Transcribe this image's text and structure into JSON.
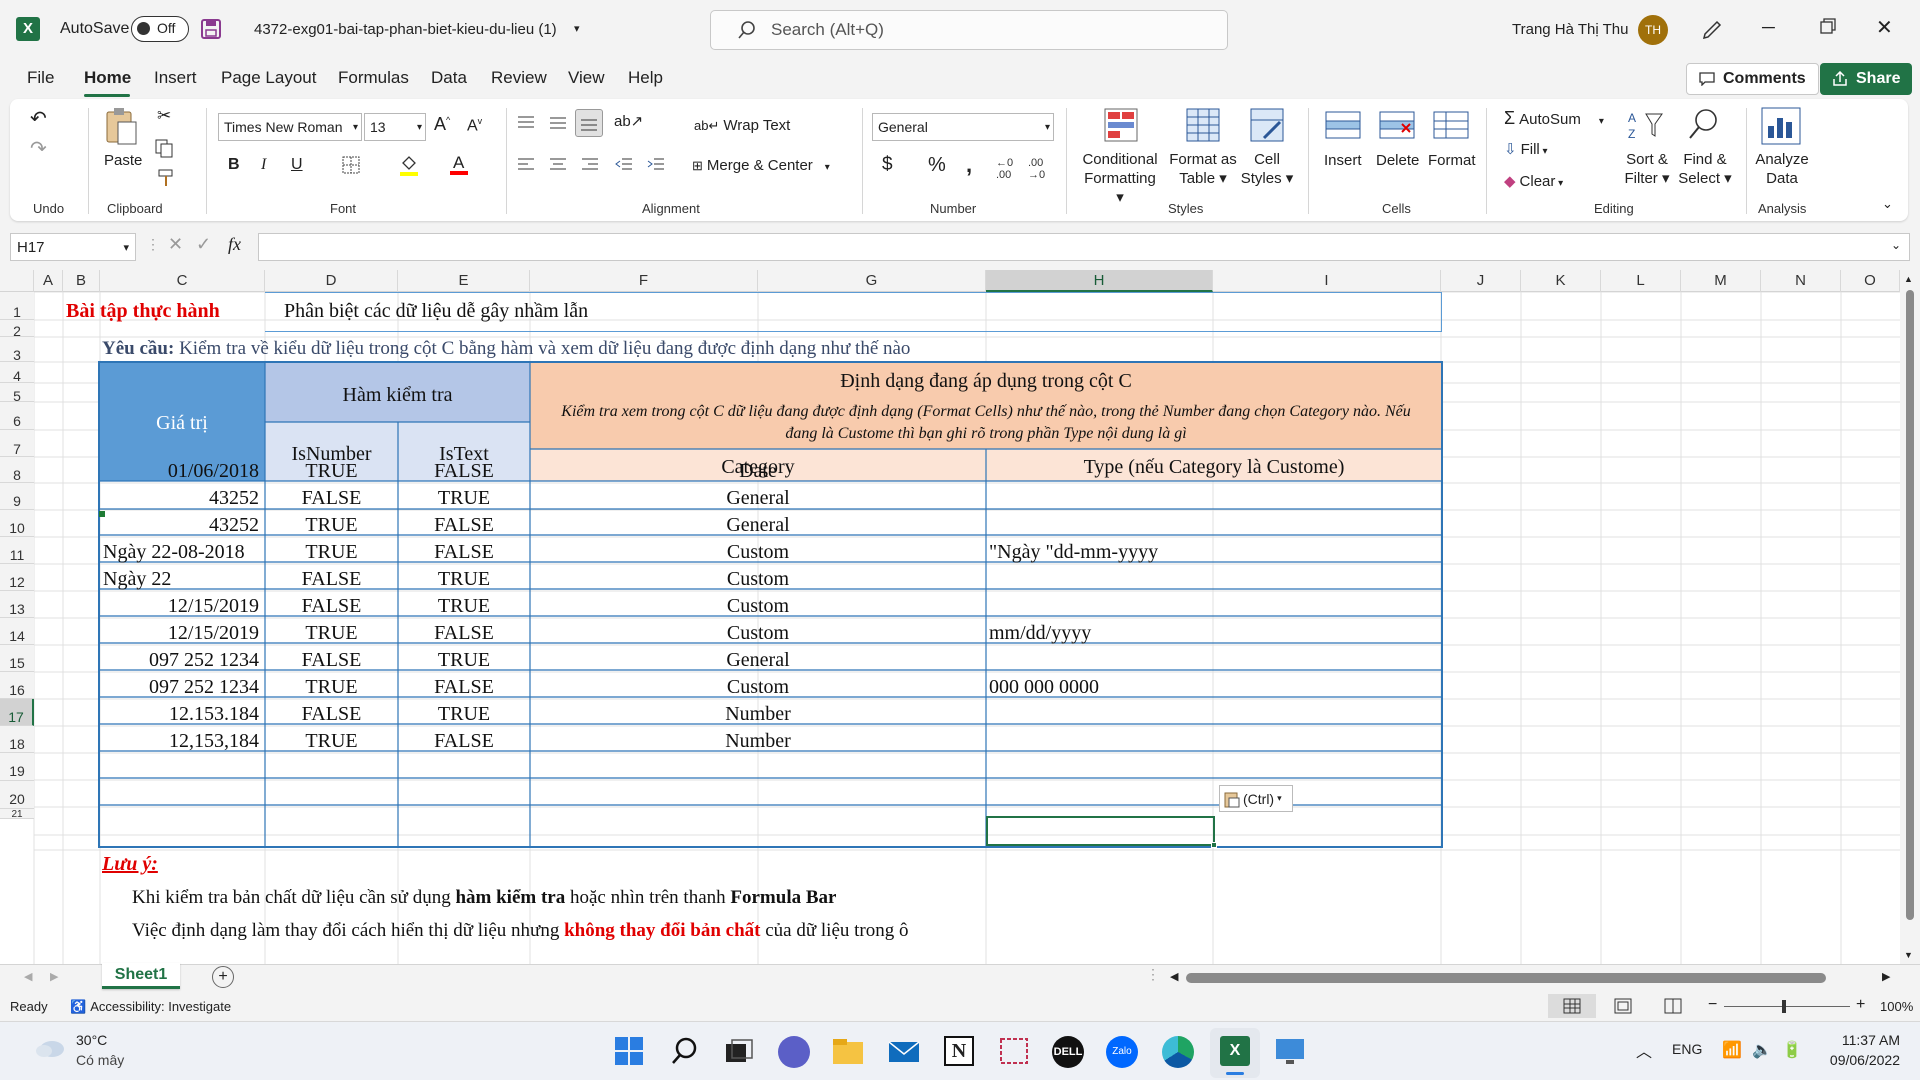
{
  "titlebar": {
    "autosave_label": "AutoSave",
    "autosave_state": "Off",
    "filename": "4372-exg01-bai-tap-phan-biet-kieu-du-lieu (1)",
    "search_placeholder": "Search (Alt+Q)",
    "user_name": "Trang Hà Thị Thu",
    "user_initials": "TH"
  },
  "menu": [
    "File",
    "Home",
    "Insert",
    "Page Layout",
    "Formulas",
    "Data",
    "Review",
    "View",
    "Help"
  ],
  "top_buttons": {
    "comments": "Comments",
    "share": "Share"
  },
  "ribbon": {
    "undo_label": "Undo",
    "clipboard": {
      "paste": "Paste",
      "label": "Clipboard"
    },
    "font": {
      "name": "Times New Roman",
      "size": "13",
      "label": "Font",
      "bold": "B",
      "italic": "I",
      "underline": "U"
    },
    "alignment": {
      "wrap_text": "Wrap Text",
      "merge_center": "Merge & Center",
      "label": "Alignment"
    },
    "number": {
      "format": "General",
      "label": "Number"
    },
    "styles": {
      "conditional": [
        "Conditional",
        "Formatting"
      ],
      "format_table": [
        "Format as",
        "Table"
      ],
      "cell_styles": [
        "Cell",
        "Styles"
      ],
      "label": "Styles"
    },
    "cells": {
      "insert": "Insert",
      "delete": "Delete",
      "format": "Format",
      "label": "Cells"
    },
    "editing": {
      "autosum": "AutoSum",
      "fill": "Fill",
      "clear": "Clear",
      "sort_filter": [
        "Sort &",
        "Filter"
      ],
      "find_select": [
        "Find &",
        "Select"
      ],
      "label": "Editing"
    },
    "analysis": {
      "analyze": [
        "Analyze",
        "Data"
      ],
      "label": "Analysis"
    }
  },
  "formula_bar": {
    "name_box": "H17",
    "fx": "fx",
    "content": ""
  },
  "columns": [
    "A",
    "B",
    "C",
    "D",
    "E",
    "F",
    "G",
    "H",
    "I",
    "J",
    "K",
    "L",
    "M",
    "N",
    "O"
  ],
  "rows": [
    "1",
    "2",
    "3",
    "4",
    "5",
    "6",
    "7",
    "8",
    "9",
    "10",
    "11",
    "12",
    "13",
    "14",
    "15",
    "16",
    "17",
    "18",
    "19",
    "20"
  ],
  "sheet": {
    "title_label": "Bài tập thực hành",
    "title_text": "Phân biệt các dữ liệu dễ gây nhầm lẫn",
    "req_label": "Yêu cầu:",
    "req_text": " Kiểm tra về kiểu dữ liệu trong cột C bằng hàm và xem dữ liệu đang được định dạng như thế nào",
    "hdr_value": "Giá trị",
    "hdr_check": "Hàm kiểm tra",
    "hdr_isnumber": "IsNumber",
    "hdr_istext": "IsText",
    "hdr_format": "Định dạng đang áp dụng trong cột C",
    "hdr_format_note": "Kiểm tra xem trong cột C dữ liệu đang được định dạng (Format Cells) như thế nào, trong thẻ Number đang chọn Category nào. Nếu đang là Custome thì bạn ghi rõ trong phần Type nội dung là gì",
    "hdr_category": "Category",
    "hdr_type": "Type (nếu Category là Custome)",
    "table": [
      {
        "value": "01/06/2018",
        "align": "r",
        "isnum": "TRUE",
        "istext": "FALSE",
        "category": "Date",
        "type": ""
      },
      {
        "value": "43252",
        "align": "r",
        "isnum": "FALSE",
        "istext": "TRUE",
        "category": "General",
        "type": ""
      },
      {
        "value": "43252",
        "align": "r",
        "isnum": "TRUE",
        "istext": "FALSE",
        "category": "General",
        "type": ""
      },
      {
        "value": "Ngày 22-08-2018",
        "align": "l",
        "isnum": "TRUE",
        "istext": "FALSE",
        "category": "Custom",
        "type": "\"Ngày \"dd-mm-yyyy"
      },
      {
        "value": "Ngày 22",
        "align": "l",
        "isnum": "FALSE",
        "istext": "TRUE",
        "category": "Custom",
        "type": ""
      },
      {
        "value": "12/15/2019",
        "align": "r",
        "isnum": "FALSE",
        "istext": "TRUE",
        "category": "Custom",
        "type": ""
      },
      {
        "value": "12/15/2019",
        "align": "r",
        "isnum": "TRUE",
        "istext": "FALSE",
        "category": "Custom",
        "type": "mm/dd/yyyy"
      },
      {
        "value": "097 252 1234",
        "align": "r",
        "isnum": "FALSE",
        "istext": "TRUE",
        "category": "General",
        "type": ""
      },
      {
        "value": "097 252 1234",
        "align": "r",
        "isnum": "TRUE",
        "istext": "FALSE",
        "category": "Custom",
        "type": "000 000 0000"
      },
      {
        "value": "12.153.184",
        "align": "r",
        "isnum": "FALSE",
        "istext": "TRUE",
        "category": "Number",
        "type": ""
      },
      {
        "value": "12,153,184",
        "align": "r",
        "isnum": "TRUE",
        "istext": "FALSE",
        "category": "Number",
        "type": ""
      }
    ],
    "note_label": "Lưu ý:",
    "note1_a": "Khi kiểm tra bản chất dữ liệu cần sử dụng ",
    "note1_b": "hàm kiểm tra",
    "note1_c": " hoặc nhìn trên thanh ",
    "note1_d": "Formula Bar",
    "note2_a": "Việc định dạng làm thay đổi cách hiển thị dữ liệu nhưng ",
    "note2_b": "không thay đổi bản chất",
    "note2_c": " của dữ liệu trong ô",
    "paste_options": "(Ctrl)"
  },
  "sheet_tab": "Sheet1",
  "status": {
    "ready": "Ready",
    "accessibility": "Accessibility: Investigate",
    "zoom": "100%"
  },
  "taskbar": {
    "temp": "30°C",
    "weather": "Có mây",
    "lang": "ENG",
    "time": "11:37 AM",
    "date": "09/06/2022"
  },
  "colors": {
    "excel_green": "#217346",
    "header_blue": "#5b9bd5",
    "subheader_blue": "#b4c6e7",
    "peach": "#f8cbad",
    "light_peach": "#fce4d6",
    "red": "#e00000"
  }
}
